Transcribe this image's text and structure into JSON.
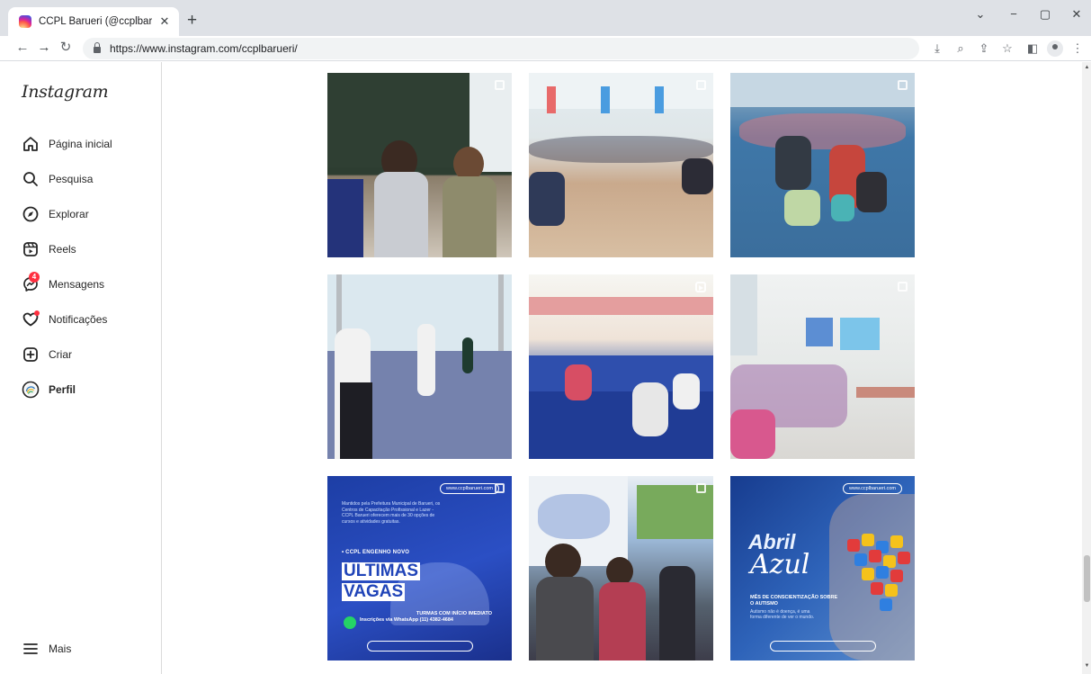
{
  "browser": {
    "tab_title": "CCPL Barueri (@ccplbarueri) • Fo",
    "tab_close": "✕",
    "new_tab": "+",
    "url": "https://www.instagram.com/ccplbarueri/",
    "window_controls": [
      "⌄",
      "−",
      "▢",
      "✕"
    ]
  },
  "sidebar": {
    "logo": "Instagram",
    "items": [
      {
        "label": "Página inicial",
        "icon": "home-icon"
      },
      {
        "label": "Pesquisa",
        "icon": "search-icon"
      },
      {
        "label": "Explorar",
        "icon": "compass-icon"
      },
      {
        "label": "Reels",
        "icon": "reels-icon"
      },
      {
        "label": "Mensagens",
        "icon": "messenger-icon",
        "badge": "4"
      },
      {
        "label": "Notificações",
        "icon": "heart-icon"
      },
      {
        "label": "Criar",
        "icon": "plus-square-icon"
      },
      {
        "label": "Perfil",
        "icon": "avatar"
      }
    ],
    "more": {
      "label": "Mais",
      "icon": "menu-icon"
    }
  },
  "grid": {
    "promo": {
      "url": "www.ccplbarueri.com",
      "top_text": "Mantidos pela Prefeitura Municipal de Barueri, os Centros de Capacitação Profissional e Lazer - CCPL Barueri oferecem mais de 30 opções de cursos e atividades gratuitas.",
      "subtitle": "• CCPL ENGENHO NOVO",
      "line1": "ÚLTIMAS",
      "line2": "VAGAS",
      "whatsapp": "Inscrições via WhatsApp (11) 4382-4684",
      "turmas": "TURMAS COM INÍCIO IMEDIATO"
    },
    "abril": {
      "word1": "Abril",
      "word2": "Azul",
      "title": "MÊS DE CONSCIENTIZAÇÃO SOBRE O AUTISMO",
      "text": "Autismo não é doença, é uma forma diferente de ver o mundo."
    }
  },
  "colors": {
    "badge": "#ff3040",
    "promo_blue": "#2044b8",
    "border": "#dbdbdb"
  }
}
